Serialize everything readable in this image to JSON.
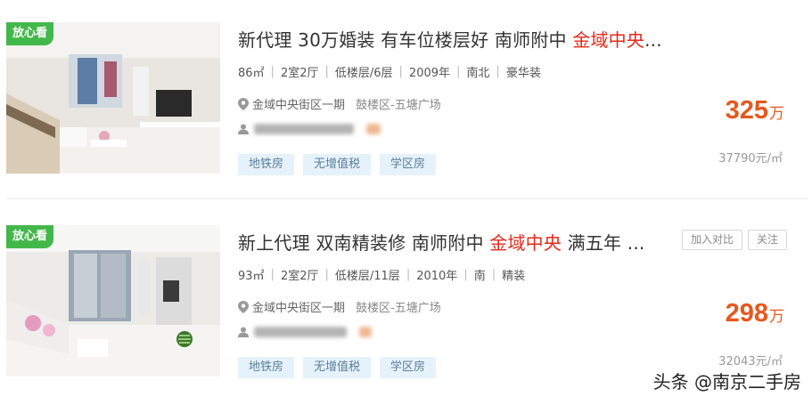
{
  "listings": [
    {
      "badge": "放心看",
      "title_prefix": "新代理 30万婚装 有车位楼层好 南师附中 ",
      "title_highlight": "金域中央",
      "title_suffix": "...",
      "attrs": [
        "86㎡",
        "2室2厅",
        "低楼层/6层",
        "2009年",
        "南北",
        "豪华装"
      ],
      "community": "金域中央街区一期",
      "area": "鼓楼区-五塘广场",
      "tags": [
        "地铁房",
        "无增值税",
        "学区房"
      ],
      "price": "325",
      "price_unit": "万",
      "unit_price": "37790元/㎡"
    },
    {
      "badge": "放心看",
      "title_prefix": "新上代理 双南精装修 南师附中 ",
      "title_highlight": "金域中央",
      "title_suffix": " 满五年 ...",
      "attrs": [
        "93㎡",
        "2室2厅",
        "低楼层/11层",
        "2010年",
        "南",
        "精装"
      ],
      "community": "金域中央街区一期",
      "area": "鼓楼区-五塘广场",
      "tags": [
        "地铁房",
        "无增值税",
        "学区房"
      ],
      "price": "298",
      "price_unit": "万",
      "unit_price": "32043元/㎡",
      "compare_button": "加入对比",
      "follow_button": "关注"
    }
  ],
  "watermark": "头条 @南京二手房"
}
